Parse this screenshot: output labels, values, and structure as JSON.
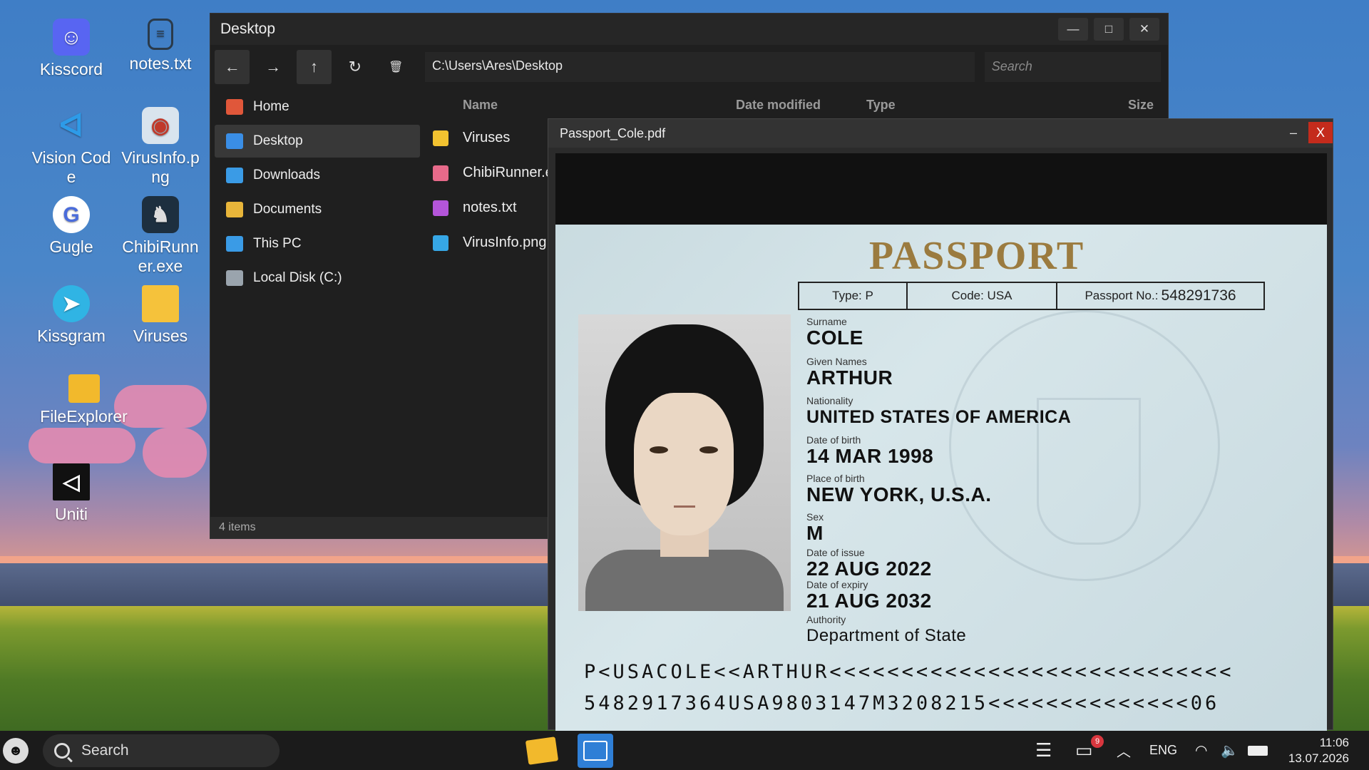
{
  "desktop": {
    "icons": [
      {
        "label": "Kisscord",
        "icon": "kisscord-icon"
      },
      {
        "label": "notes.txt",
        "icon": "text-file-icon"
      },
      {
        "label": "Vision Code",
        "icon": "vision-code-icon"
      },
      {
        "label": "VirusInfo.png",
        "icon": "image-file-icon"
      },
      {
        "label": "Gugle",
        "icon": "gugle-browser-icon"
      },
      {
        "label": "ChibiRunner.exe",
        "icon": "game-exe-icon"
      },
      {
        "label": "Kissgram",
        "icon": "kissgram-icon"
      },
      {
        "label": "Viruses",
        "icon": "folder-icon"
      },
      {
        "label": "FileExplorer",
        "icon": "file-explorer-icon"
      },
      {
        "label": "Uniti",
        "icon": "uniti-icon"
      }
    ]
  },
  "explorer": {
    "title": "Desktop",
    "controls": {
      "minimize": "—",
      "maximize": "□",
      "close": "✕"
    },
    "toolbar": {
      "back": "←",
      "forward": "→",
      "up": "↑",
      "refresh": "↻",
      "delete": "🗑"
    },
    "address": "C:\\Users\\Ares\\Desktop",
    "search_placeholder": "Search",
    "sidebar": [
      {
        "label": "Home",
        "color": "#e0573a"
      },
      {
        "label": "Desktop",
        "color": "#3a8ee6"
      },
      {
        "label": "Downloads",
        "color": "#3a9be6"
      },
      {
        "label": "Documents",
        "color": "#e8b53a"
      },
      {
        "label": "This PC",
        "color": "#3a9be6"
      },
      {
        "label": "Local Disk (C:)",
        "color": "#9aa4ad"
      }
    ],
    "columns": {
      "name": "Name",
      "date": "Date modified",
      "type": "Type",
      "size": "Size"
    },
    "files": [
      {
        "name": "Viruses",
        "color": "#f2c230"
      },
      {
        "name": "ChibiRunner.exe",
        "color": "#e76a8a"
      },
      {
        "name": "notes.txt",
        "color": "#b455d9"
      },
      {
        "name": "VirusInfo.png",
        "color": "#36a7e6"
      }
    ],
    "status": "4 items"
  },
  "pdf": {
    "title": "Passport_Cole.pdf",
    "minimize": "–",
    "close": "X",
    "passport": {
      "heading": "PASSPORT",
      "type": "Type: P",
      "code": "Code: USA",
      "number_label": "Passport No.:",
      "number": "548291736",
      "fields": [
        {
          "label": "Surname",
          "value": "COLE"
        },
        {
          "label": "Given Names",
          "value": "ARTHUR"
        },
        {
          "label": "Nationality",
          "value": "UNITED STATES OF AMERICA"
        },
        {
          "label": "Date of birth",
          "value": "14 MAR 1998"
        },
        {
          "label": "Place of birth",
          "value": "NEW YORK, U.S.A."
        },
        {
          "label": "Sex",
          "value": "M"
        },
        {
          "label": "Date of issue",
          "value": "22 AUG 2022"
        },
        {
          "label": "Date of expiry",
          "value": "21 AUG 2032"
        },
        {
          "label": "Authority",
          "value": "Department of State"
        }
      ],
      "mrz": [
        "P<USACOLE<<ARTHUR<<<<<<<<<<<<<<<<<<<<<<<<<<<<",
        "5482917364USA9803147M3208215<<<<<<<<<<<<<<06"
      ]
    }
  },
  "taskbar": {
    "search": "Search",
    "notification_count": "9",
    "language": "ENG",
    "time": "11:06",
    "date": "13.07.2026"
  }
}
